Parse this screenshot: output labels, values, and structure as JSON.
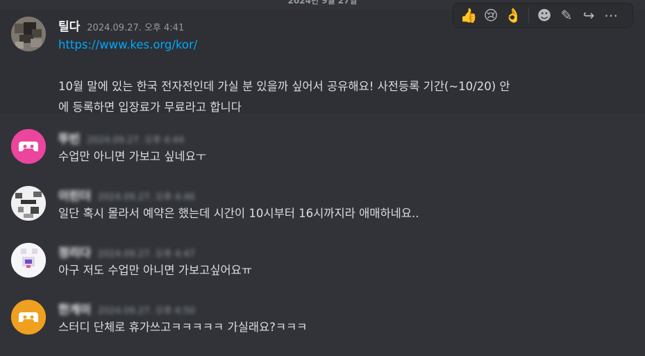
{
  "date_divider": "2024년 9월 27일",
  "toolbar": {
    "reactions": [
      "👍",
      "😢",
      "👌"
    ],
    "icons": [
      "add-reaction-icon",
      "edit-icon",
      "forward-icon",
      "more-icon"
    ],
    "edit_glyph": "✎",
    "forward_glyph": "↪",
    "more_glyph": "⋯",
    "add_reaction_glyph": "☻"
  },
  "messages": [
    {
      "username": "틸다",
      "timestamp": "2024.09.27. 오후 4:41",
      "link": "https://www.kes.org/kor/",
      "text_line1": "10월 말에 있는 한국 전자전인데 가실 분 있을까 싶어서 공유해요! 사전등록 기간(~10/20) 안",
      "text_line2": "에 등록하면 입장료가 무료라고 합니다"
    },
    {
      "username": "뚜빈",
      "timestamp": "2024.09.27. 오후 4:44",
      "text": "수업만 아니면 가보고 싶네요ㅜ",
      "avatar_color": "#eb459e"
    },
    {
      "username": "이린더",
      "timestamp": "2024.09.27. 오후 4:46",
      "text": "일단 혹시 몰라서 예약은 했는데 시간이 10시부터 16시까지라 애매하네요.."
    },
    {
      "username": "정리다",
      "timestamp": "2024.09.27. 오후 4:47",
      "text": "아구 저도 수업만 아니면 가보고싶어요ㅠ"
    },
    {
      "username": "한게이",
      "timestamp": "2024.09.27. 오후 4:50",
      "text": "스터디 단체로 휴가쓰고ㅋㅋㅋㅋㅋ 가실래요?ㅋㅋㅋ",
      "avatar_color": "#f0a020"
    }
  ]
}
